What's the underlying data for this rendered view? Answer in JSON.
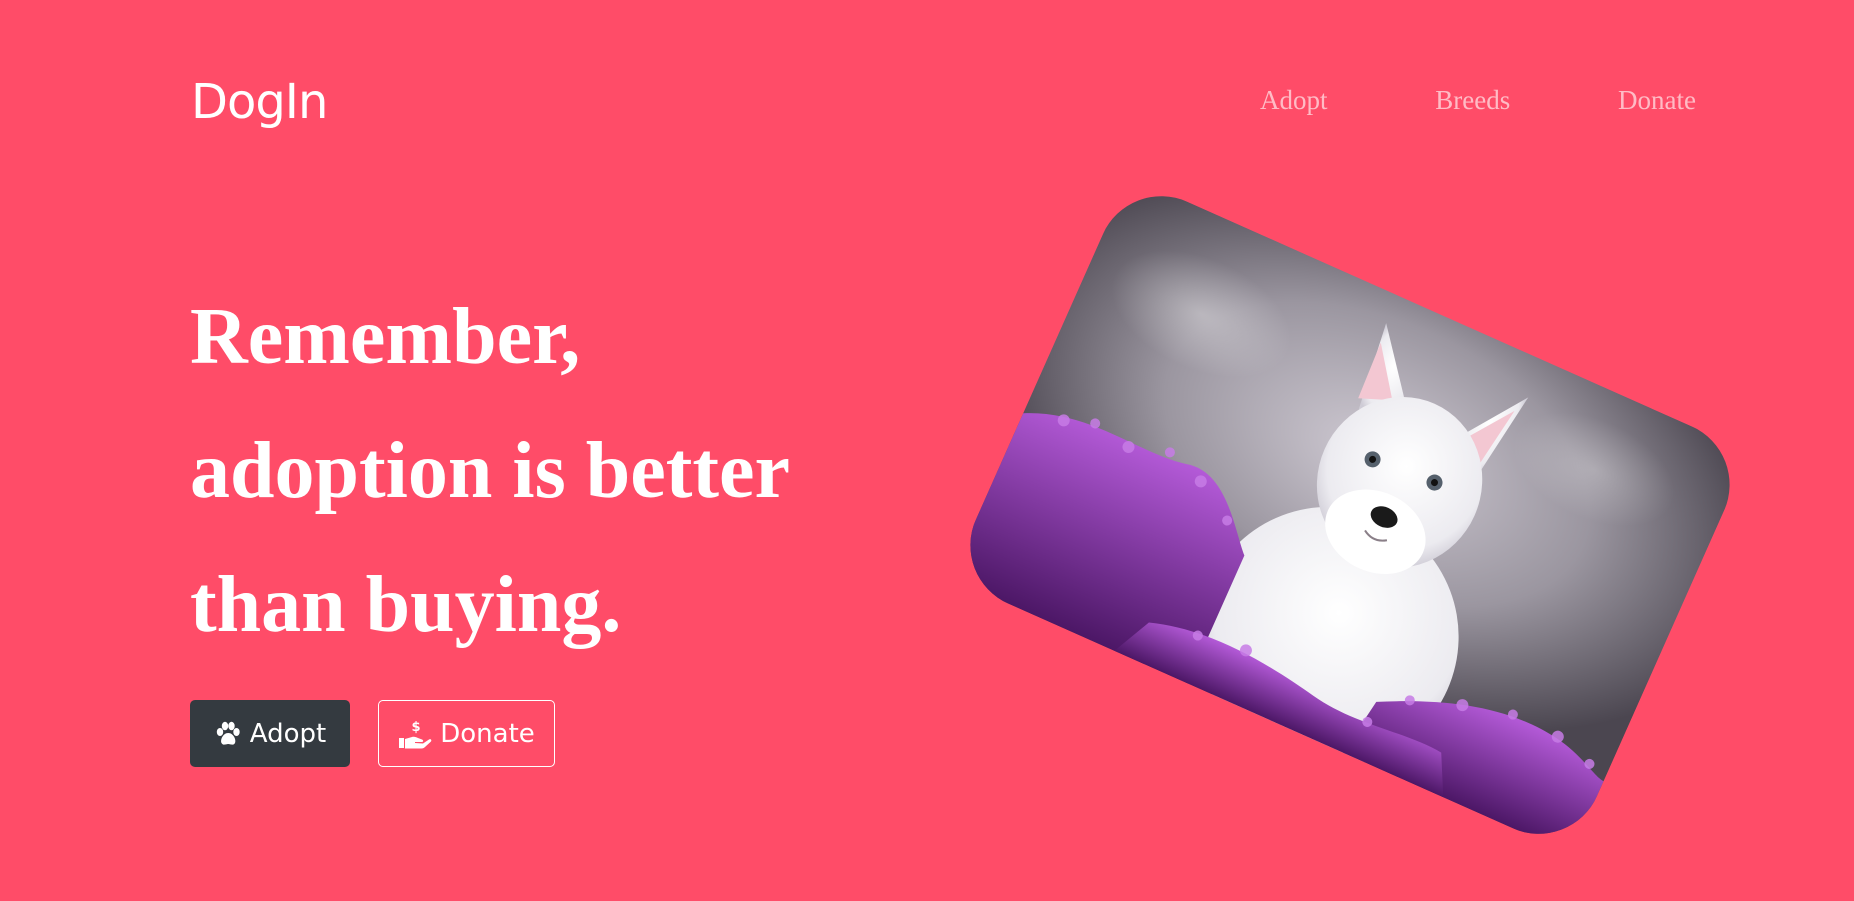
{
  "brand": {
    "name": "DogIn"
  },
  "nav": {
    "items": [
      "Adopt",
      "Breeds",
      "Donate"
    ]
  },
  "hero": {
    "headline_lines": [
      "Remember,",
      "adoption is better",
      "than buying."
    ],
    "adopt_button": {
      "label": "Adopt",
      "icon": "paw-icon"
    },
    "donate_button": {
      "label": "Donate",
      "icon": "hand-donate-icon"
    }
  },
  "image": {
    "subject": "dog-in-flowers-photo"
  },
  "colors": {
    "background": "#ff4c68",
    "adopt_button": "#343a40",
    "text": "#ffffff"
  }
}
